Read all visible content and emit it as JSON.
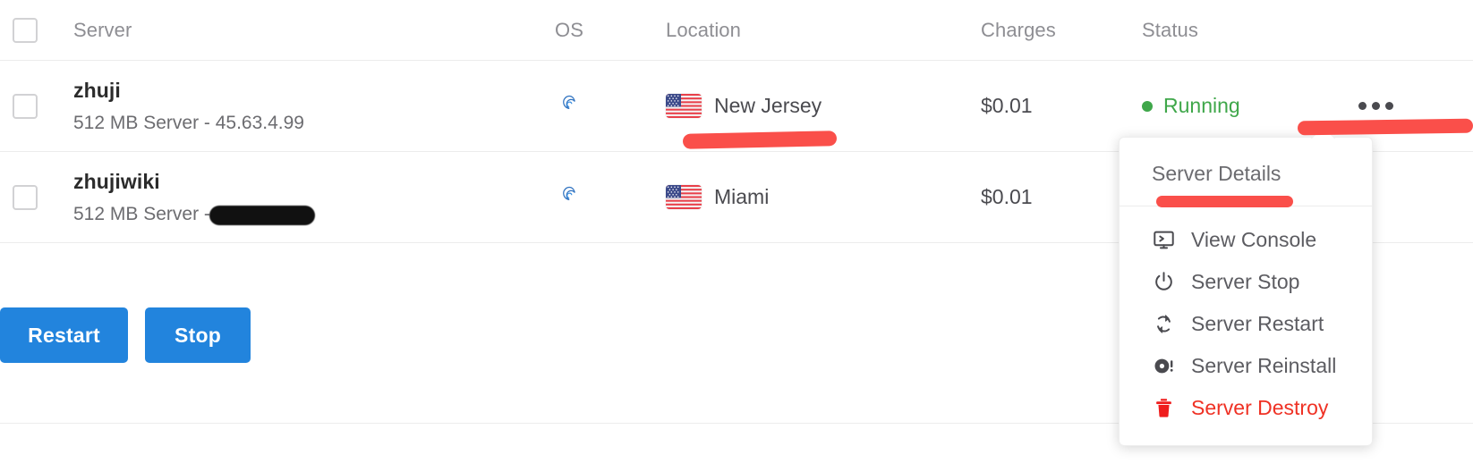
{
  "table": {
    "columns": [
      {
        "key": "checkbox",
        "label": ""
      },
      {
        "key": "server",
        "label": "Server"
      },
      {
        "key": "os",
        "label": "OS"
      },
      {
        "key": "location",
        "label": "Location"
      },
      {
        "key": "charges",
        "label": "Charges"
      },
      {
        "key": "status",
        "label": "Status"
      }
    ],
    "rows": [
      {
        "name": "zhuji",
        "meta": "512 MB Server - 45.63.4.99",
        "meta_redacted": false,
        "os": "debian-icon",
        "flag": "us-flag-icon",
        "location": "New Jersey",
        "charges": "$0.01",
        "status": "Running",
        "status_color": "#3fa74a",
        "has_menu": true
      },
      {
        "name": "zhujiwiki",
        "meta": "512 MB Server - 45",
        "meta_redacted": true,
        "os": "debian-icon",
        "flag": "us-flag-icon",
        "location": "Miami",
        "charges": "$0.01",
        "status": "",
        "status_color": "#3fa74a",
        "has_menu": false
      }
    ]
  },
  "actions": {
    "restart_label": "Restart",
    "stop_label": "Stop",
    "button_color": "#2284dd"
  },
  "dropdown": {
    "header": "Server Details",
    "items": [
      {
        "label": "View Console",
        "icon": "monitor-console-icon",
        "danger": false
      },
      {
        "label": "Server Stop",
        "icon": "power-icon",
        "danger": false
      },
      {
        "label": "Server Restart",
        "icon": "refresh-icon",
        "danger": false
      },
      {
        "label": "Server Reinstall",
        "icon": "disc-alert-icon",
        "danger": false
      },
      {
        "label": "Server Destroy",
        "icon": "trash-icon",
        "danger": true
      }
    ],
    "danger_color": "#ef3124"
  },
  "annotations": {
    "marker_color": "#fa4f4a",
    "strokes": [
      "location-underline",
      "kebab-menu-underline",
      "server-details-underline"
    ]
  }
}
